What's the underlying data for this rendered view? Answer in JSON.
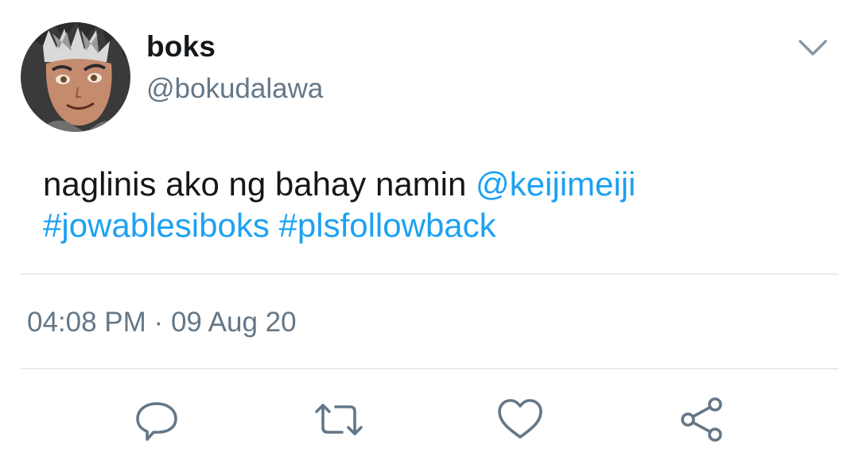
{
  "user": {
    "display_name": "boks",
    "handle": "@bokudalawa",
    "avatar_icon": "anime-avatar"
  },
  "tweet": {
    "text_plain": "naglinis ako ng bahay namin",
    "mention": "@keijimeiji",
    "hashtags": [
      "#jowablesiboks",
      "#plsfollowback"
    ],
    "time": "04:08 PM",
    "separator": "·",
    "date": "09 Aug 20"
  },
  "actions": {
    "reply_icon": "reply-icon",
    "retweet_icon": "retweet-icon",
    "like_icon": "heart-icon",
    "share_icon": "share-icon"
  },
  "menu": {
    "icon": "chevron-down-icon"
  },
  "colors": {
    "link": "#1da1f2",
    "secondary_text": "#657786",
    "primary_text": "#14171a",
    "divider": "#e6ecf0",
    "icon": "#657786"
  }
}
